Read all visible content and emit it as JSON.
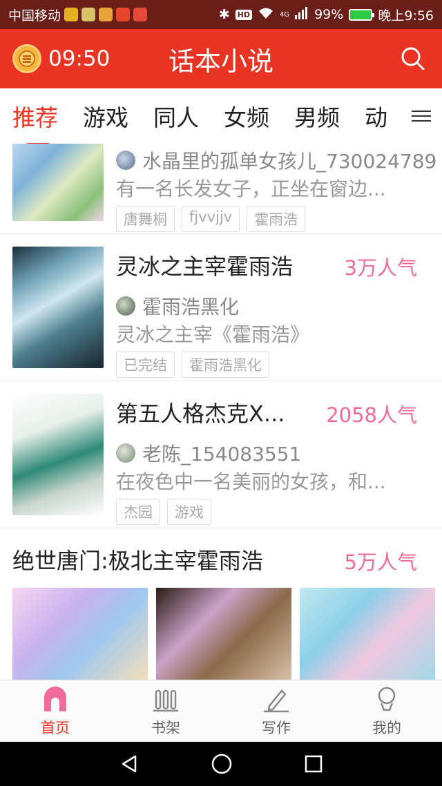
{
  "status_bar": {
    "carrier": "中国移动",
    "network_type": "4G",
    "battery_percent": "99%",
    "time": "晚上9:56"
  },
  "header": {
    "timer": "09:50",
    "title": "话本小说",
    "search_icon": "search-icon"
  },
  "tabs": [
    {
      "label": "推荐",
      "active": true
    },
    {
      "label": "游戏",
      "active": false
    },
    {
      "label": "同人",
      "active": false
    },
    {
      "label": "女频",
      "active": false
    },
    {
      "label": "男频",
      "active": false
    },
    {
      "label": "动",
      "active": false
    }
  ],
  "books": [
    {
      "title": "",
      "author": "水晶里的孤单女孩儿_730024789",
      "description": "有一名长发女子，正坐在窗边...",
      "tags": [
        "唐舞桐",
        "fjvvjjv",
        "霍雨浩"
      ]
    },
    {
      "title": "灵冰之主宰霍雨浩",
      "popularity": "3万人气",
      "author": "霍雨浩黑化",
      "description": "灵冰之主宰《霍雨浩》",
      "tags": [
        "已完结",
        "霍雨浩黑化"
      ]
    },
    {
      "title": "第五人格杰克X...",
      "popularity": "2058人气",
      "author": "老陈_154083551",
      "description": "在夜色中一名美丽的女孩，和...",
      "tags": [
        "杰园",
        "游戏"
      ]
    }
  ],
  "featured": {
    "title": "绝世唐门:极北主宰霍雨浩",
    "popularity": "5万人气"
  },
  "bottom_nav": [
    {
      "label": "首页",
      "icon": "home-icon",
      "active": true
    },
    {
      "label": "书架",
      "icon": "bookshelf-icon",
      "active": false
    },
    {
      "label": "写作",
      "icon": "pencil-icon",
      "active": false
    },
    {
      "label": "我的",
      "icon": "profile-icon",
      "active": false
    }
  ],
  "colors": {
    "brand_red": "#e93323",
    "popularity_pink": "#f06a9a",
    "status_bar": "#6b1d17"
  }
}
